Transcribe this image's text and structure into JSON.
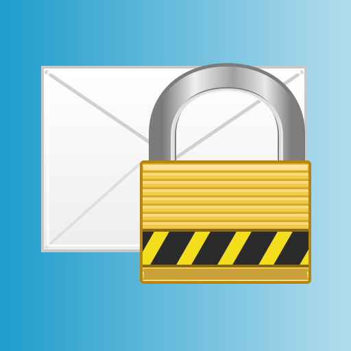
{
  "icon": {
    "name": "email-lock-icon",
    "parts": [
      "envelope-icon",
      "padlock-icon",
      "hazard-stripe"
    ]
  },
  "colors": {
    "background_left": "#1e9ccb",
    "background_right": "#b3dced",
    "envelope_fill": "#fbfbfb",
    "envelope_border": "#c9c9c9",
    "envelope_fold": "#d9d9d9",
    "shackle": "#8e8e8e",
    "shackle_highlight": "#e6e6e6",
    "lock_body": "#f2c84a",
    "lock_body_dark": "#d9a820",
    "lock_border": "#b88410",
    "stripe_dark": "#2a2a2a",
    "stripe_yellow": "#f4dd1a"
  }
}
